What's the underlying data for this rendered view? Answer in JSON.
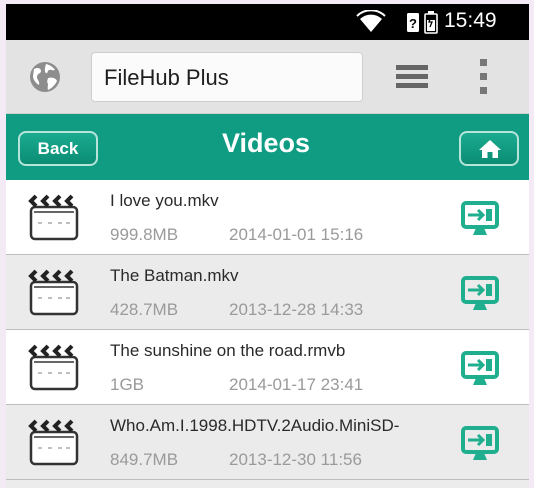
{
  "status_bar": {
    "time": "15:49",
    "icons": [
      "wifi-icon",
      "sim-unknown-icon",
      "battery-icon"
    ]
  },
  "app_bar": {
    "title": "FileHub Plus",
    "icons": [
      "globe-icon",
      "list-view-icon",
      "overflow-menu-icon"
    ]
  },
  "toolbar": {
    "back_label": "Back",
    "title": "Videos",
    "home_icon": "home-icon"
  },
  "files": [
    {
      "name": "I love you.mkv",
      "size": "999.8MB",
      "date": "2014-01-01 15:16"
    },
    {
      "name": "The Batman.mkv",
      "size": "428.7MB",
      "date": "2013-12-28 14:33"
    },
    {
      "name": "The sunshine on the road.rmvb",
      "size": "1GB",
      "date": "2014-01-17 23:41"
    },
    {
      "name": "Who.Am.I.1998.HDTV.2Audio.MiniSD-",
      "size": "849.7MB",
      "date": "2013-12-30 11:56"
    }
  ],
  "colors": {
    "accent": "#0f9c82",
    "cast_icon": "#1fae8e",
    "status_bar": "#000000"
  }
}
